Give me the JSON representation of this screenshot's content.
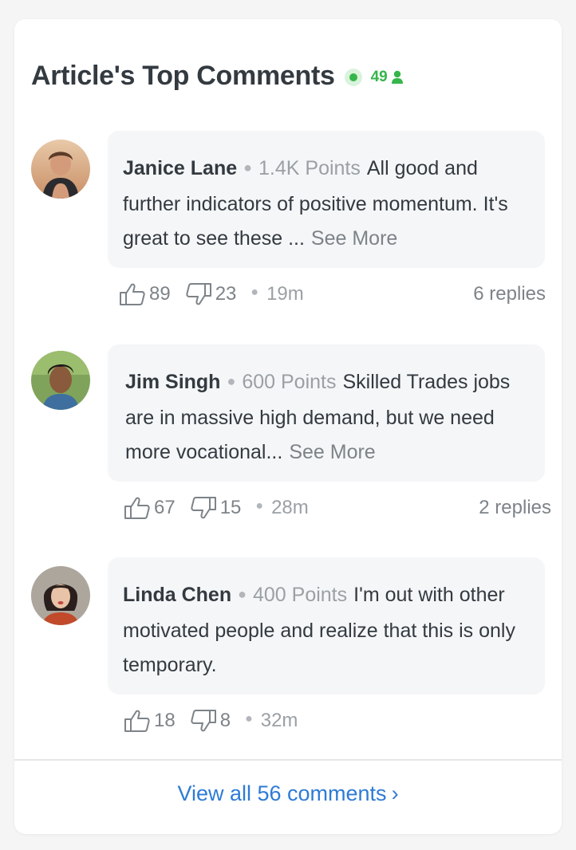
{
  "header": {
    "title": "Article's Top Comments",
    "online_count": "49",
    "online_color": "#35b64a"
  },
  "comments": [
    {
      "author": "Janice Lane",
      "points": "1.4K Points",
      "text": "All good and further indicators of positive momentum. It's great to see these ...",
      "see_more": "See More",
      "likes": "89",
      "dislikes": "23",
      "time": "19m",
      "replies": "6 replies"
    },
    {
      "author": "Jim Singh",
      "points": "600 Points",
      "text": "Skilled Trades jobs are in massive high demand, but we need more vocational...",
      "see_more": "See More",
      "likes": "67",
      "dislikes": "15",
      "time": "28m",
      "replies": "2 replies"
    },
    {
      "author": "Linda Chen",
      "points": "400 Points",
      "text": "I'm out with other motivated people and realize that this is only temporary.",
      "likes": "18",
      "dislikes": "8",
      "time": "32m"
    }
  ],
  "footer": {
    "view_all": "View all 56 comments",
    "chevron": "›",
    "link_color": "#2e7bd6"
  },
  "icons": {
    "online": "status-dot-icon",
    "user": "user-icon",
    "like": "thumbs-up-icon",
    "dislike": "thumbs-down-icon",
    "more": "chevron-right-icon"
  }
}
